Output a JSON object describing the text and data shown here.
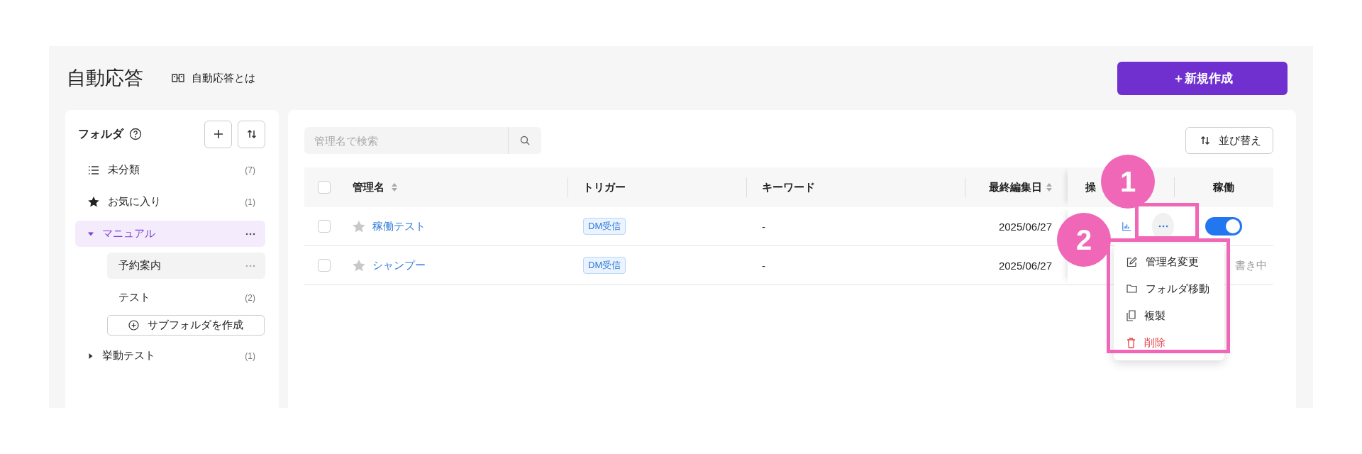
{
  "header": {
    "title": "自動応答",
    "help_link": "自動応答とは",
    "create_button": "＋新規作成"
  },
  "sidebar": {
    "title": "フォルダ",
    "items": [
      {
        "kind": "list",
        "label": "未分類",
        "count": "(7)"
      },
      {
        "kind": "star",
        "label": "お気に入り",
        "count": "(1)"
      },
      {
        "kind": "folder",
        "label": "マニュアル",
        "selected": true,
        "expanded": true,
        "highlighted": false,
        "add_subfolder": "サブフォルダを作成",
        "children": [
          {
            "label": "予約案内",
            "selected": false,
            "highlighted": true
          },
          {
            "label": "テスト",
            "count": "(2)",
            "selected": false,
            "highlighted": false
          }
        ]
      },
      {
        "kind": "folder",
        "label": "挙動テスト",
        "count": "(1)",
        "selected": false,
        "expanded": false,
        "highlighted": false
      }
    ]
  },
  "search": {
    "placeholder": "管理名で検索"
  },
  "sort_button": "並び替え",
  "table": {
    "columns": [
      "管理名",
      "トリガー",
      "キーワード",
      "最終編集日",
      "操",
      "稼働"
    ],
    "header_checked": false,
    "rows": [
      {
        "checked": false,
        "starred": false,
        "name": "稼働テスト",
        "trigger": "DM受信",
        "keyword": "-",
        "date": "2025/06/27",
        "actions_shown": true,
        "status": {
          "kind": "toggle",
          "on": true
        }
      },
      {
        "checked": false,
        "starred": false,
        "name": "シャンプー",
        "trigger": "DM受信",
        "keyword": "-",
        "date": "2025/06/27",
        "status": {
          "kind": "text",
          "text": "書き中"
        }
      }
    ]
  },
  "menu": [
    {
      "kind": "normal",
      "label": "管理名変更"
    },
    {
      "kind": "normal",
      "label": "フォルダ移動"
    },
    {
      "kind": "normal",
      "label": "複製"
    },
    {
      "kind": "danger",
      "label": "削除"
    }
  ],
  "annotations": [
    {
      "label": "1"
    },
    {
      "label": "2"
    }
  ]
}
